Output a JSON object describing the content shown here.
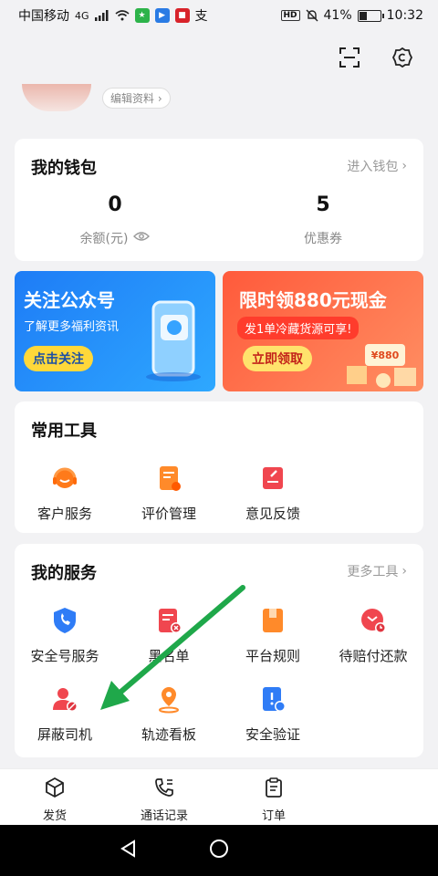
{
  "status_bar": {
    "carrier": "中国移动",
    "network": "4G",
    "battery": "41%",
    "battery_level": 0.41,
    "time": "10:32",
    "hd": "HD",
    "pay_glyph": "支"
  },
  "profile": {
    "edit_label": "编辑资料"
  },
  "wallet": {
    "title": "我的钱包",
    "link_label": "进入钱包",
    "balance_value": "0",
    "balance_label": "余额(元)",
    "coupon_value": "5",
    "coupon_label": "优惠券"
  },
  "banners": {
    "left": {
      "title": "关注公众号",
      "subtitle": "了解更多福利资讯",
      "button": "点击关注"
    },
    "right": {
      "title": "限时领880元现金",
      "subtitle": "发1单冷藏货源可享!",
      "button": "立即领取",
      "tag": "¥880"
    }
  },
  "tools": {
    "title": "常用工具",
    "items": [
      {
        "label": "客户服务",
        "icon": "headset-icon"
      },
      {
        "label": "评价管理",
        "icon": "review-icon"
      },
      {
        "label": "意见反馈",
        "icon": "feedback-icon"
      }
    ]
  },
  "services": {
    "title": "我的服务",
    "link_label": "更多工具",
    "items": [
      {
        "label": "安全号服务",
        "icon": "shield-phone-icon"
      },
      {
        "label": "黑名单",
        "icon": "blacklist-icon"
      },
      {
        "label": "平台规则",
        "icon": "rules-book-icon"
      },
      {
        "label": "待赔付还款",
        "icon": "repay-clock-icon"
      },
      {
        "label": "屏蔽司机",
        "icon": "block-driver-icon"
      },
      {
        "label": "轨迹看板",
        "icon": "track-board-icon"
      },
      {
        "label": "安全验证",
        "icon": "security-verify-icon"
      }
    ]
  },
  "bottom_nav": {
    "items": [
      {
        "label": "发货",
        "icon": "box-icon"
      },
      {
        "label": "通话记录",
        "icon": "call-log-icon"
      },
      {
        "label": "订单",
        "icon": "order-clipboard-icon"
      }
    ]
  },
  "colors": {
    "accent_orange": "#ff6a1a",
    "accent_red": "#f0464f",
    "accent_blue": "#2f7cf6",
    "arrow_green": "#1fa84a"
  }
}
